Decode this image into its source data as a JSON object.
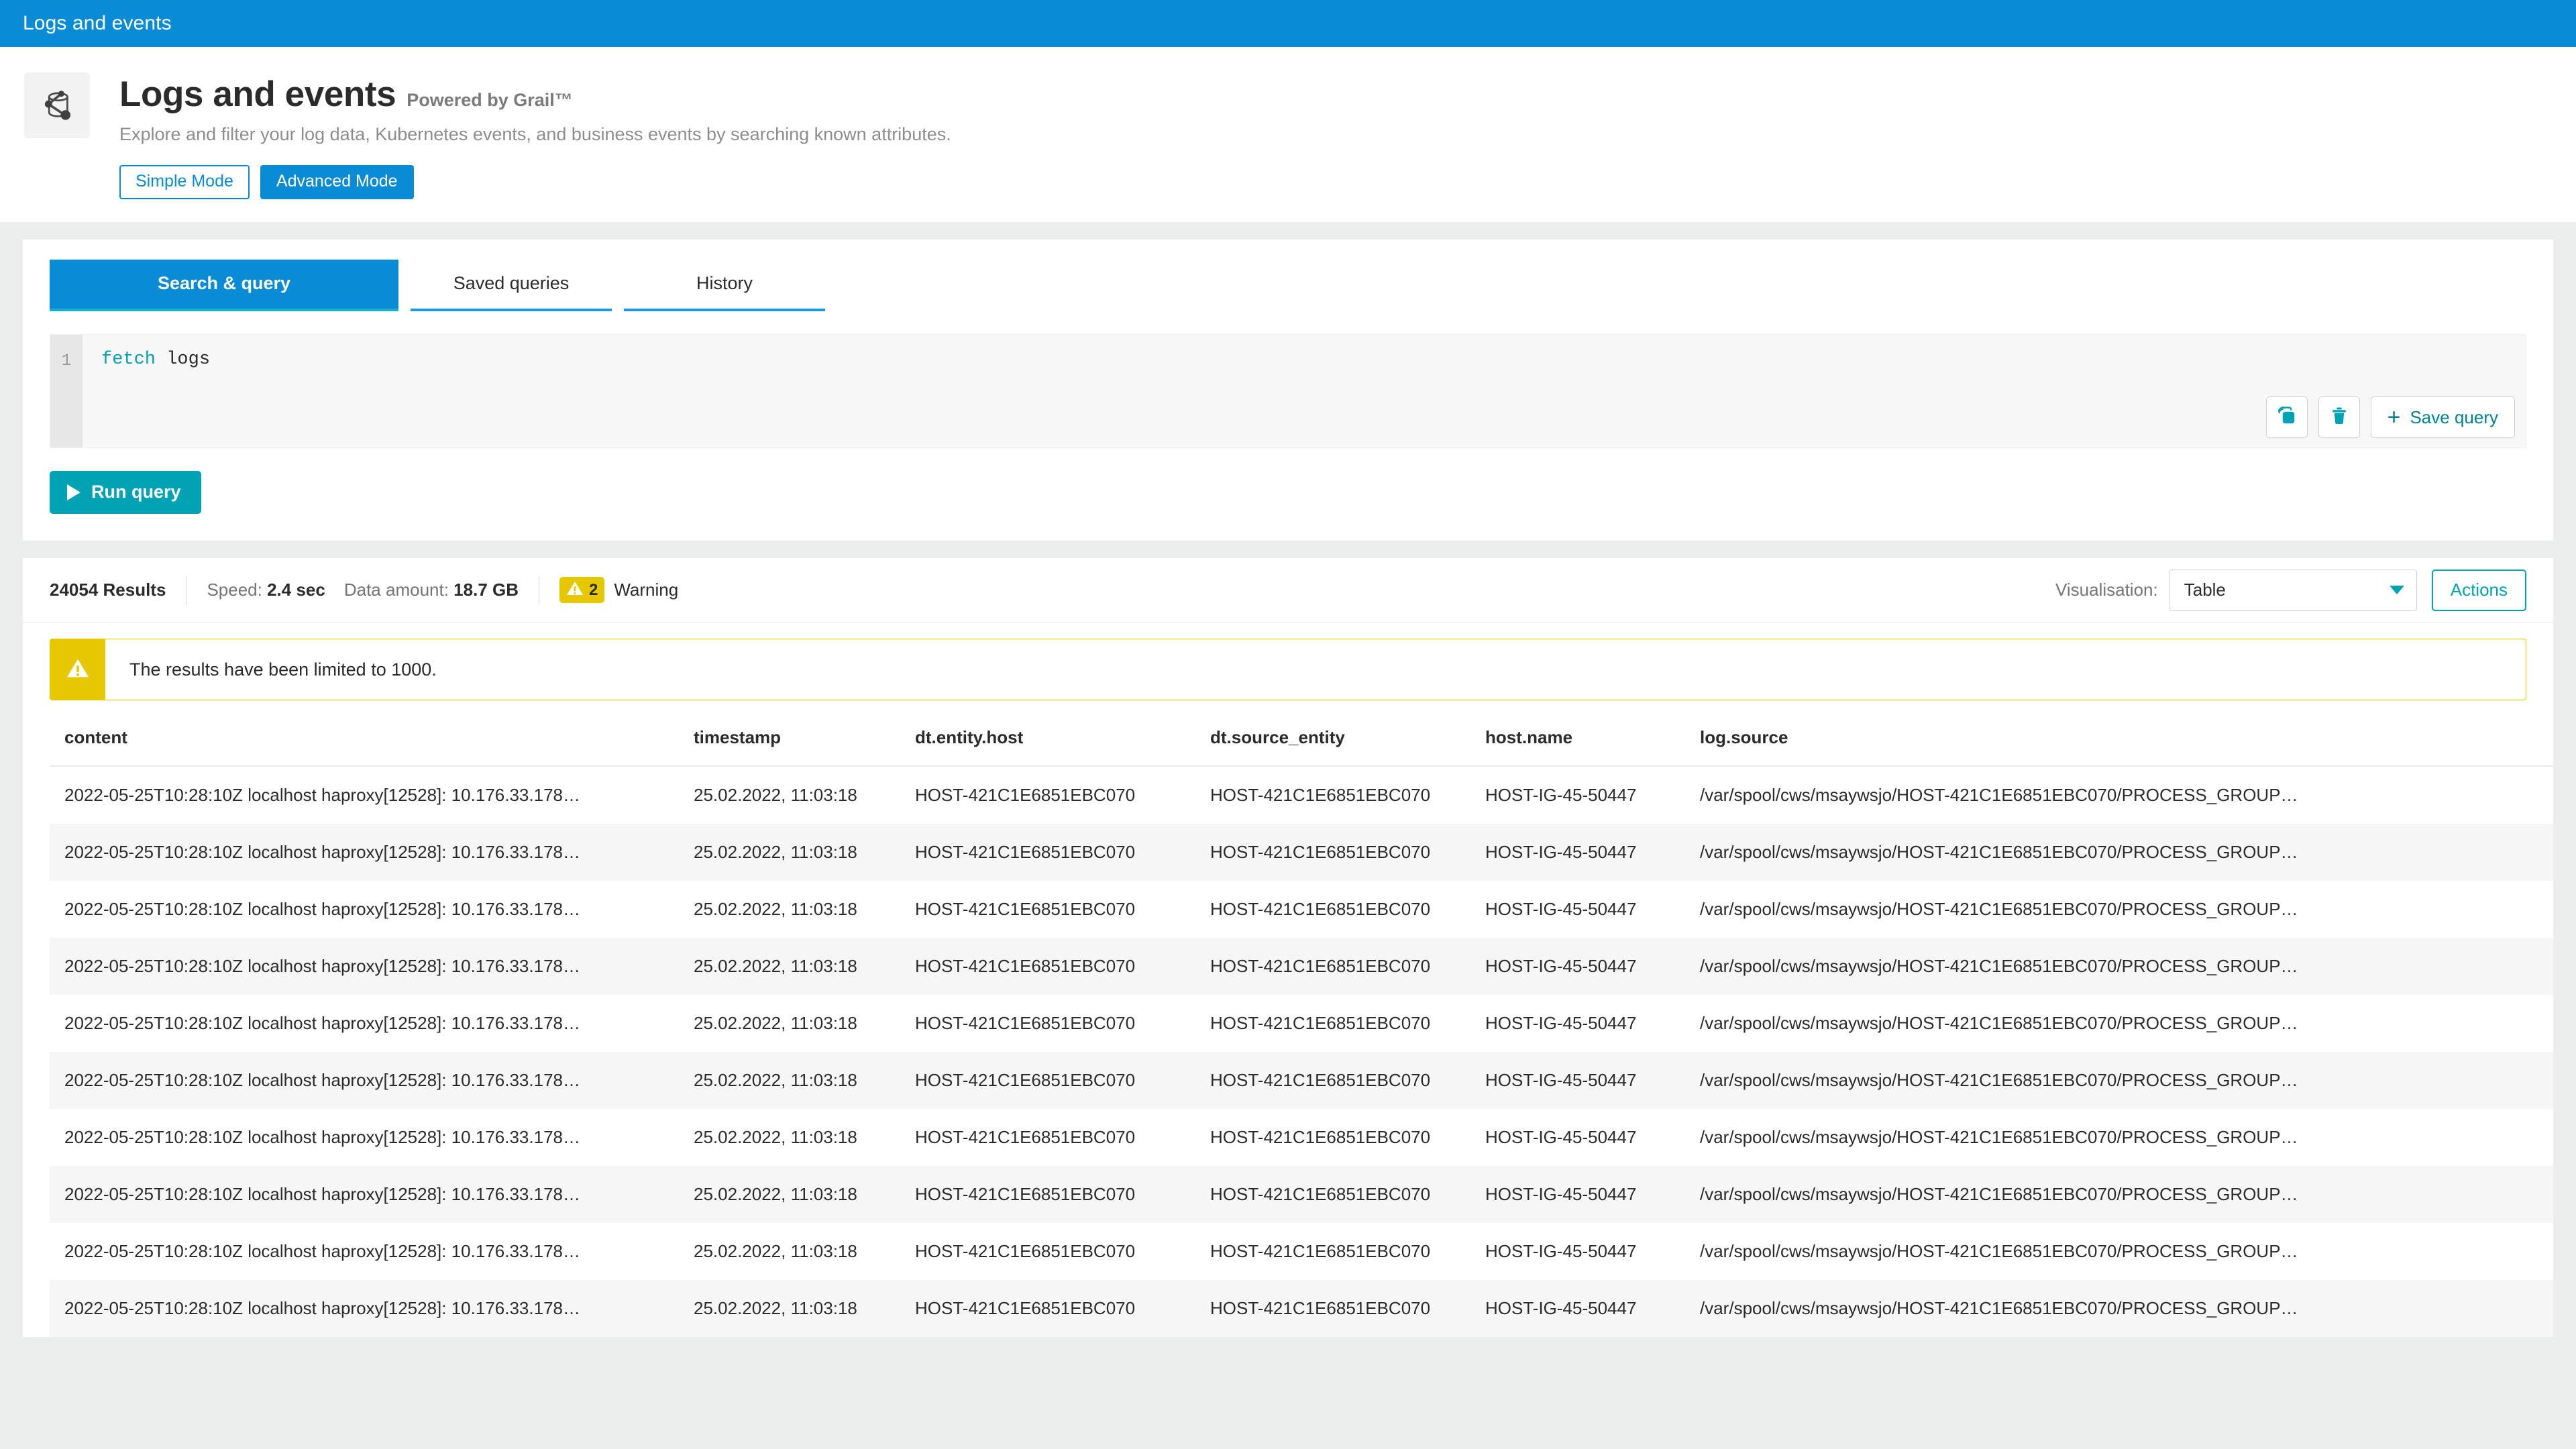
{
  "appbar": {
    "title": "Logs and events"
  },
  "header": {
    "icon": "grail-database-icon",
    "title": "Logs and events",
    "powered_by": "Powered by Grail™",
    "subtitle": "Explore and filter your log data, Kubernetes events, and business events by searching known attributes.",
    "modes": [
      {
        "label": "Simple Mode",
        "active": false
      },
      {
        "label": "Advanced Mode",
        "active": true
      }
    ]
  },
  "query": {
    "tabs": [
      {
        "label": "Search & query",
        "active": true
      },
      {
        "label": "Saved queries",
        "active": false
      },
      {
        "label": "History",
        "active": false
      }
    ],
    "editor": {
      "line_number": "1",
      "keyword": "fetch",
      "argument": "logs"
    },
    "tools": {
      "copy_icon": "copy-icon",
      "delete_icon": "trash-icon",
      "save_label": "Save query",
      "plus_icon": "plus-icon"
    },
    "run_label": "Run query",
    "run_icon": "play-icon"
  },
  "results": {
    "count_label": "24054 Results",
    "speed_label": "Speed:",
    "speed_value": "2.4 sec",
    "data_amount_label": "Data amount:",
    "data_amount_value": "18.7 GB",
    "warning_count": "2",
    "warning_label": "Warning",
    "warning_icon": "warning-triangle-icon",
    "visualisation_label": "Visualisation:",
    "visualisation_value": "Table",
    "visualisation_chevron": "chevron-down-icon",
    "actions_label": "Actions",
    "banner": {
      "icon": "warning-triangle-icon",
      "text": "The results have been limited to 1000."
    },
    "columns": [
      "content",
      "timestamp",
      "dt.entity.host",
      "dt.source_entity",
      "host.name",
      "log.source"
    ],
    "rows": [
      {
        "content": "2022-05-25T10:28:10Z localhost haproxy[12528]: 10.176.33.178…",
        "timestamp": "25.02.2022, 11:03:18",
        "dt_entity_host": "HOST-421C1E6851EBC070",
        "dt_source_entity": "HOST-421C1E6851EBC070",
        "host_name": "HOST-IG-45-50447",
        "log_source": "/var/spool/cws/msaywsjo/HOST-421C1E6851EBC070/PROCESS_GROUP…"
      },
      {
        "content": "2022-05-25T10:28:10Z localhost haproxy[12528]: 10.176.33.178…",
        "timestamp": "25.02.2022, 11:03:18",
        "dt_entity_host": "HOST-421C1E6851EBC070",
        "dt_source_entity": "HOST-421C1E6851EBC070",
        "host_name": "HOST-IG-45-50447",
        "log_source": "/var/spool/cws/msaywsjo/HOST-421C1E6851EBC070/PROCESS_GROUP…"
      },
      {
        "content": "2022-05-25T10:28:10Z localhost haproxy[12528]: 10.176.33.178…",
        "timestamp": "25.02.2022, 11:03:18",
        "dt_entity_host": "HOST-421C1E6851EBC070",
        "dt_source_entity": "HOST-421C1E6851EBC070",
        "host_name": "HOST-IG-45-50447",
        "log_source": "/var/spool/cws/msaywsjo/HOST-421C1E6851EBC070/PROCESS_GROUP…"
      },
      {
        "content": "2022-05-25T10:28:10Z localhost haproxy[12528]: 10.176.33.178…",
        "timestamp": "25.02.2022, 11:03:18",
        "dt_entity_host": "HOST-421C1E6851EBC070",
        "dt_source_entity": "HOST-421C1E6851EBC070",
        "host_name": "HOST-IG-45-50447",
        "log_source": "/var/spool/cws/msaywsjo/HOST-421C1E6851EBC070/PROCESS_GROUP…"
      },
      {
        "content": "2022-05-25T10:28:10Z localhost haproxy[12528]: 10.176.33.178…",
        "timestamp": "25.02.2022, 11:03:18",
        "dt_entity_host": "HOST-421C1E6851EBC070",
        "dt_source_entity": "HOST-421C1E6851EBC070",
        "host_name": "HOST-IG-45-50447",
        "log_source": "/var/spool/cws/msaywsjo/HOST-421C1E6851EBC070/PROCESS_GROUP…"
      },
      {
        "content": "2022-05-25T10:28:10Z localhost haproxy[12528]: 10.176.33.178…",
        "timestamp": "25.02.2022, 11:03:18",
        "dt_entity_host": "HOST-421C1E6851EBC070",
        "dt_source_entity": "HOST-421C1E6851EBC070",
        "host_name": "HOST-IG-45-50447",
        "log_source": "/var/spool/cws/msaywsjo/HOST-421C1E6851EBC070/PROCESS_GROUP…"
      },
      {
        "content": "2022-05-25T10:28:10Z localhost haproxy[12528]: 10.176.33.178…",
        "timestamp": "25.02.2022, 11:03:18",
        "dt_entity_host": "HOST-421C1E6851EBC070",
        "dt_source_entity": "HOST-421C1E6851EBC070",
        "host_name": "HOST-IG-45-50447",
        "log_source": "/var/spool/cws/msaywsjo/HOST-421C1E6851EBC070/PROCESS_GROUP…"
      },
      {
        "content": "2022-05-25T10:28:10Z localhost haproxy[12528]: 10.176.33.178…",
        "timestamp": "25.02.2022, 11:03:18",
        "dt_entity_host": "HOST-421C1E6851EBC070",
        "dt_source_entity": "HOST-421C1E6851EBC070",
        "host_name": "HOST-IG-45-50447",
        "log_source": "/var/spool/cws/msaywsjo/HOST-421C1E6851EBC070/PROCESS_GROUP…"
      },
      {
        "content": "2022-05-25T10:28:10Z localhost haproxy[12528]: 10.176.33.178…",
        "timestamp": "25.02.2022, 11:03:18",
        "dt_entity_host": "HOST-421C1E6851EBC070",
        "dt_source_entity": "HOST-421C1E6851EBC070",
        "host_name": "HOST-IG-45-50447",
        "log_source": "/var/spool/cws/msaywsjo/HOST-421C1E6851EBC070/PROCESS_GROUP…"
      },
      {
        "content": "2022-05-25T10:28:10Z localhost haproxy[12528]: 10.176.33.178…",
        "timestamp": "25.02.2022, 11:03:18",
        "dt_entity_host": "HOST-421C1E6851EBC070",
        "dt_source_entity": "HOST-421C1E6851EBC070",
        "host_name": "HOST-IG-45-50447",
        "log_source": "/var/spool/cws/msaywsjo/HOST-421C1E6851EBC070/PROCESS_GROUP…"
      }
    ]
  },
  "colors": {
    "appbar_blue": "#0a8bd6",
    "accent_teal": "#00a2b3",
    "link_teal": "#0095a8",
    "warning_yellow": "#e6c800",
    "page_bg": "#eceded"
  }
}
